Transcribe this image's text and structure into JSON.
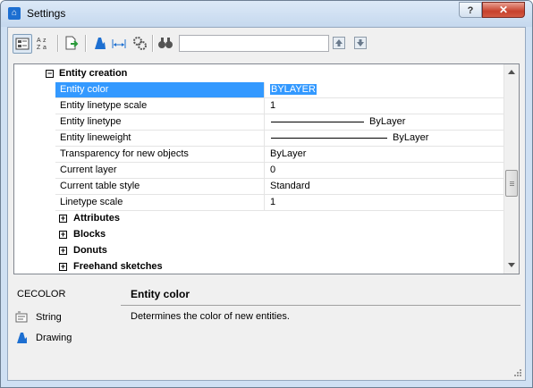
{
  "window": {
    "title": "Settings",
    "help_label": "?",
    "close_label": "✕"
  },
  "toolbar": {
    "search": {
      "value": "",
      "placeholder": ""
    },
    "icons": [
      "categorized-view-icon",
      "alphabetic-sort-icon",
      "export-icon",
      "drawing-settings-icon",
      "dimension-icon",
      "gear-settings-icon",
      "binoculars-search-icon",
      "arrow-up-icon",
      "arrow-down-icon"
    ]
  },
  "grid": {
    "category": {
      "label": "Entity creation",
      "toggle": "−"
    },
    "properties": [
      {
        "name": "Entity color",
        "value": "BYLAYER",
        "selected": true
      },
      {
        "name": "Entity linetype scale",
        "value": "1"
      },
      {
        "name": "Entity linetype",
        "value": "ByLayer",
        "linetype": true
      },
      {
        "name": "Entity lineweight",
        "value": "ByLayer",
        "lineweight": true
      },
      {
        "name": "Transparency for new objects",
        "value": "ByLayer"
      },
      {
        "name": "Current layer",
        "value": "0"
      },
      {
        "name": "Current table style",
        "value": "Standard"
      },
      {
        "name": "Linetype scale",
        "value": "1"
      }
    ],
    "subcategories": [
      {
        "label": "Attributes",
        "toggle": "+"
      },
      {
        "label": "Blocks",
        "toggle": "+"
      },
      {
        "label": "Donuts",
        "toggle": "+"
      },
      {
        "label": "Freehand sketches",
        "toggle": "+"
      }
    ]
  },
  "info": {
    "variable": "CECOLOR",
    "type_label": "String",
    "scope_label": "Drawing",
    "title": "Entity color",
    "description": "Determines the color of new entities."
  },
  "colors": {
    "selection": "#3399ff",
    "accent": "#1d6fd1"
  }
}
